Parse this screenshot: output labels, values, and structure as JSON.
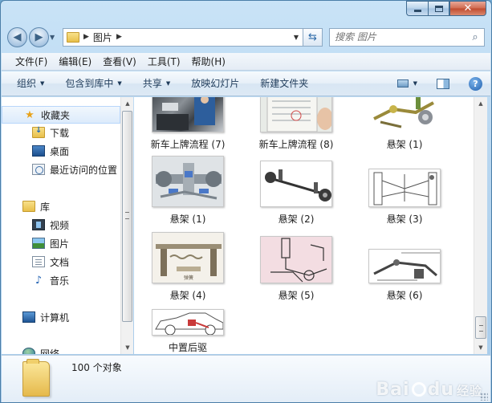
{
  "window": {
    "caption_buttons": {
      "minimize_icon": "minimize-icon",
      "maximize_icon": "maximize-icon",
      "close_glyph": "✕"
    }
  },
  "address_bar": {
    "breadcrumb": "图片",
    "search_placeholder": "搜索 图片"
  },
  "menu": [
    "文件(F)",
    "编辑(E)",
    "查看(V)",
    "工具(T)",
    "帮助(H)"
  ],
  "commands": {
    "organize": "组织",
    "include_in_library": "包含到库中",
    "share": "共享",
    "slideshow": "放映幻灯片",
    "new_folder": "新建文件夹",
    "help_glyph": "?"
  },
  "nav": {
    "favorites": "收藏夹",
    "downloads": "下载",
    "desktop": "桌面",
    "recent": "最近访问的位置",
    "libraries": "库",
    "videos": "视频",
    "pictures": "图片",
    "documents": "文档",
    "music": "音乐",
    "computer": "计算机",
    "network": "网络"
  },
  "files": [
    {
      "label": "新车上牌流程 (7)",
      "kind": "photo-dark"
    },
    {
      "label": "新车上牌流程 (8)",
      "kind": "photo-doc"
    },
    {
      "label": "悬架 (1)",
      "kind": "suspension-arm"
    },
    {
      "label": "悬架 (1)",
      "kind": "suspension-3d"
    },
    {
      "label": "悬架 (2)",
      "kind": "axle"
    },
    {
      "label": "悬架 (3)",
      "kind": "strut-diagram"
    },
    {
      "label": "悬架 (4)",
      "kind": "beam-axle"
    },
    {
      "label": "悬架 (5)",
      "kind": "sketch-pink"
    },
    {
      "label": "悬架 (6)",
      "kind": "link-diagram"
    },
    {
      "label": "中置后驱",
      "kind": "car-outline"
    }
  ],
  "details": {
    "count_text": "100 个对象"
  },
  "watermark": {
    "brand": "Bai",
    "brand_end": "du",
    "suffix": "经验"
  }
}
